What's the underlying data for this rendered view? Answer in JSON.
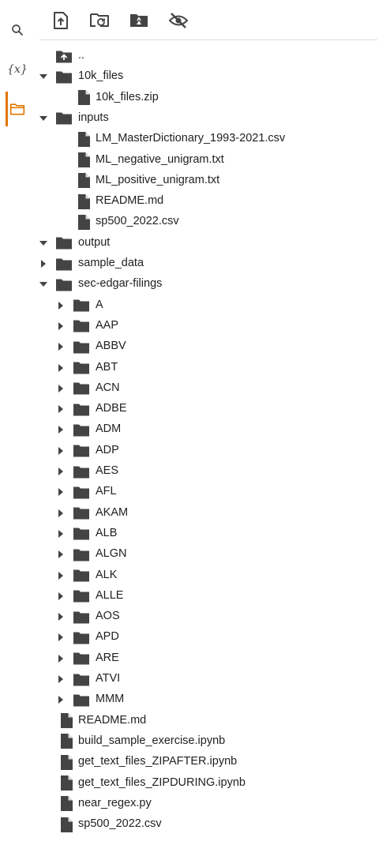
{
  "sidebar": {
    "search_icon": "search-icon",
    "variables_label": "{x}",
    "files_icon": "folder-icon",
    "accent_color": "#e37400"
  },
  "toolbar": {
    "buttons": [
      "upload-file-icon",
      "refresh-icon",
      "mount-drive-icon",
      "hide-icon"
    ]
  },
  "tree": [
    {
      "label": "..",
      "type": "up",
      "depth": 0
    },
    {
      "label": "10k_files",
      "type": "folder",
      "depth": 0,
      "expanded": true
    },
    {
      "label": "10k_files.zip",
      "type": "file",
      "depth": 1
    },
    {
      "label": "inputs",
      "type": "folder",
      "depth": 0,
      "expanded": true
    },
    {
      "label": "LM_MasterDictionary_1993-2021.csv",
      "type": "file",
      "depth": 1
    },
    {
      "label": "ML_negative_unigram.txt",
      "type": "file",
      "depth": 1
    },
    {
      "label": "ML_positive_unigram.txt",
      "type": "file",
      "depth": 1
    },
    {
      "label": "README.md",
      "type": "file",
      "depth": 1
    },
    {
      "label": "sp500_2022.csv",
      "type": "file",
      "depth": 1
    },
    {
      "label": "output",
      "type": "folder",
      "depth": 0,
      "expanded": true
    },
    {
      "label": "sample_data",
      "type": "folder",
      "depth": 0,
      "expanded": false
    },
    {
      "label": "sec-edgar-filings",
      "type": "folder",
      "depth": 0,
      "expanded": true
    },
    {
      "label": "A",
      "type": "folder",
      "depth": 1,
      "expanded": false
    },
    {
      "label": "AAP",
      "type": "folder",
      "depth": 1,
      "expanded": false
    },
    {
      "label": "ABBV",
      "type": "folder",
      "depth": 1,
      "expanded": false
    },
    {
      "label": "ABT",
      "type": "folder",
      "depth": 1,
      "expanded": false
    },
    {
      "label": "ACN",
      "type": "folder",
      "depth": 1,
      "expanded": false
    },
    {
      "label": "ADBE",
      "type": "folder",
      "depth": 1,
      "expanded": false
    },
    {
      "label": "ADM",
      "type": "folder",
      "depth": 1,
      "expanded": false
    },
    {
      "label": "ADP",
      "type": "folder",
      "depth": 1,
      "expanded": false
    },
    {
      "label": "AES",
      "type": "folder",
      "depth": 1,
      "expanded": false
    },
    {
      "label": "AFL",
      "type": "folder",
      "depth": 1,
      "expanded": false
    },
    {
      "label": "AKAM",
      "type": "folder",
      "depth": 1,
      "expanded": false
    },
    {
      "label": "ALB",
      "type": "folder",
      "depth": 1,
      "expanded": false
    },
    {
      "label": "ALGN",
      "type": "folder",
      "depth": 1,
      "expanded": false
    },
    {
      "label": "ALK",
      "type": "folder",
      "depth": 1,
      "expanded": false
    },
    {
      "label": "ALLE",
      "type": "folder",
      "depth": 1,
      "expanded": false
    },
    {
      "label": "AOS",
      "type": "folder",
      "depth": 1,
      "expanded": false
    },
    {
      "label": "APD",
      "type": "folder",
      "depth": 1,
      "expanded": false
    },
    {
      "label": "ARE",
      "type": "folder",
      "depth": 1,
      "expanded": false
    },
    {
      "label": "ATVI",
      "type": "folder",
      "depth": 1,
      "expanded": false
    },
    {
      "label": "MMM",
      "type": "folder",
      "depth": 1,
      "expanded": false
    },
    {
      "label": "README.md",
      "type": "file",
      "depth": 0
    },
    {
      "label": "build_sample_exercise.ipynb",
      "type": "file",
      "depth": 0
    },
    {
      "label": "get_text_files_ZIPAFTER.ipynb",
      "type": "file",
      "depth": 0
    },
    {
      "label": "get_text_files_ZIPDURING.ipynb",
      "type": "file",
      "depth": 0
    },
    {
      "label": "near_regex.py",
      "type": "file",
      "depth": 0
    },
    {
      "label": "sp500_2022.csv",
      "type": "file",
      "depth": 0
    }
  ]
}
